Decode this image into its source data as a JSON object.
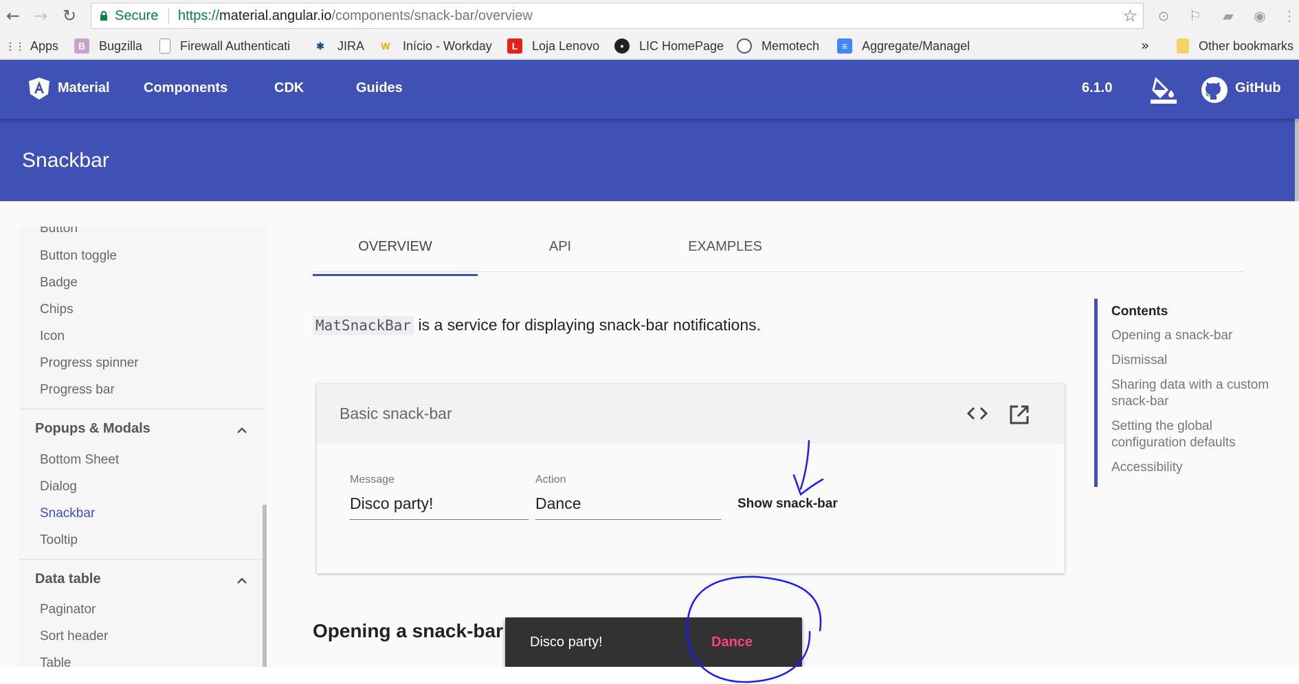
{
  "browser": {
    "secure_label": "Secure",
    "url_scheme": "https://",
    "url_host": "material.angular.io",
    "url_path": "/components/snack-bar/overview"
  },
  "bookmarks": {
    "items": [
      "Apps",
      "Bugzilla",
      "Firewall Authenticati",
      "JIRA",
      "Início - Workday",
      "Loja Lenovo",
      "LIC HomePage",
      "Memotech",
      "Aggregate/Managel"
    ],
    "overflow": "»",
    "other": "Other bookmarks"
  },
  "toolbar": {
    "brand": "Material",
    "links": [
      "Components",
      "CDK",
      "Guides"
    ],
    "version": "6.1.0",
    "github": "GitHub",
    "color": "#3f51b5"
  },
  "header": {
    "title": "Snackbar"
  },
  "sidebar": {
    "items_top": [
      "Button",
      "Button toggle",
      "Badge",
      "Chips",
      "Icon",
      "Progress spinner",
      "Progress bar"
    ],
    "group_popups": "Popups & Modals",
    "items_popups": [
      "Bottom Sheet",
      "Dialog",
      "Snackbar",
      "Tooltip"
    ],
    "group_data": "Data table",
    "items_data": [
      "Paginator",
      "Sort header",
      "Table"
    ]
  },
  "tabs": [
    "OVERVIEW",
    "API",
    "EXAMPLES"
  ],
  "intro": {
    "code": "MatSnackBar",
    "text": " is a service for displaying snack-bar notifications."
  },
  "example": {
    "title": "Basic snack-bar",
    "message_label": "Message",
    "message_value": "Disco party!",
    "action_label": "Action",
    "action_value": "Dance",
    "show_button": "Show snack-bar"
  },
  "toc": {
    "title": "Contents",
    "items": [
      "Opening a snack-bar",
      "Dismissal",
      "Sharing data with a custom snack-bar",
      "Setting the global configuration defaults",
      "Accessibility"
    ]
  },
  "section_heading": "Opening a snack-bar",
  "snackbar": {
    "message": "Disco party!",
    "action": "Dance",
    "action_color": "#ff4081"
  },
  "icons": [
    "back-icon",
    "forward-icon",
    "reload-icon",
    "lock-icon",
    "star-icon",
    "angular-logo-icon",
    "theme-bucket-icon",
    "github-icon",
    "code-icon",
    "open-in-new-icon",
    "chevron-up-icon"
  ]
}
